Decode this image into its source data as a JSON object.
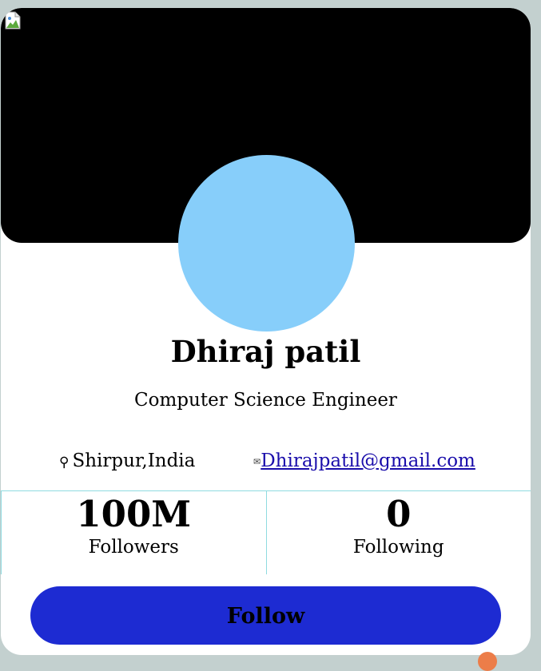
{
  "profile": {
    "name": "Dhiraj patil",
    "title": "Computer Science Engineer",
    "location": "Shirpur,India",
    "email": "Dhirajpatil@gmail.com"
  },
  "stats": {
    "followers_count": "100M",
    "followers_label": "Followers",
    "following_count": "0",
    "following_label": "Following"
  },
  "actions": {
    "follow_label": "Follow"
  },
  "icons": {
    "location": "location-pin-icon",
    "email": "mail-icon",
    "cover": "broken-image-icon"
  },
  "colors": {
    "background": "#c3d0cf",
    "cover": "#000000",
    "avatar": "#87cefa",
    "divider": "#8fdbe0",
    "follow_button": "#1d2bd2",
    "link": "#1a0dab"
  }
}
